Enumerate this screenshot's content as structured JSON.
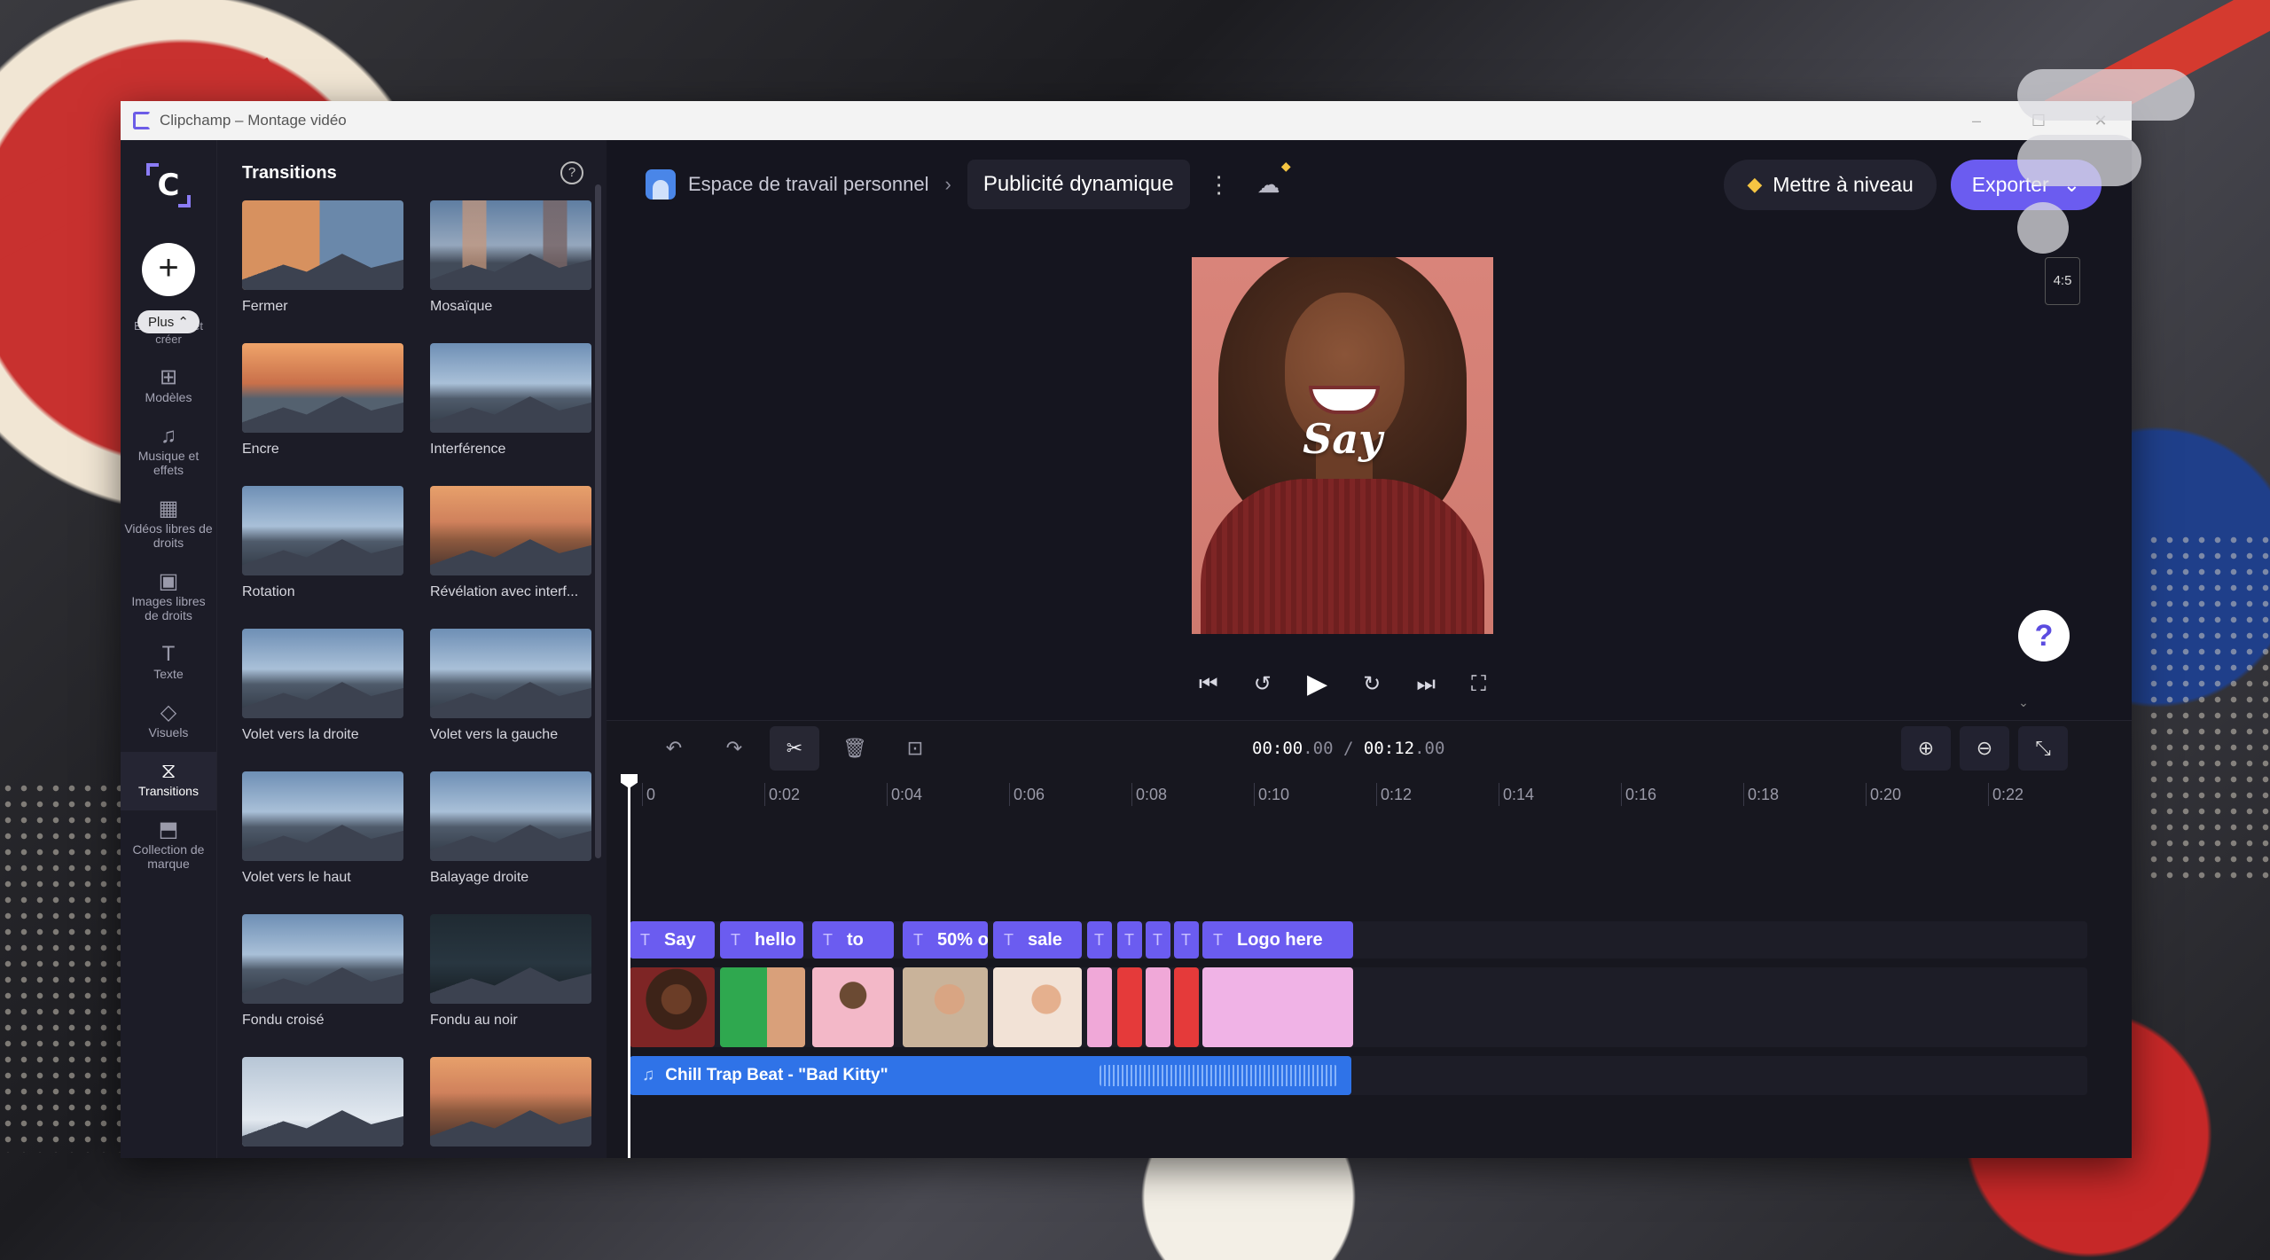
{
  "window": {
    "title": "Clipchamp – Montage vidéo"
  },
  "rail": {
    "logo": "C",
    "add_label": "+",
    "plus_pill": "Plus ⌃",
    "plus_under": "Enregistrer et créer",
    "items": [
      {
        "icon": "template-icon",
        "glyph": "⊞",
        "label": "Modèles"
      },
      {
        "icon": "music-icon",
        "glyph": "♫",
        "label": "Musique et effets"
      },
      {
        "icon": "film-icon",
        "glyph": "▦",
        "label": "Vidéos libres de droits"
      },
      {
        "icon": "image-icon",
        "glyph": "▣",
        "label": "Images libres de droits"
      },
      {
        "icon": "text-icon",
        "glyph": "T",
        "label": "Texte"
      },
      {
        "icon": "shapes-icon",
        "glyph": "◇",
        "label": "Visuels"
      },
      {
        "icon": "transitions-icon",
        "glyph": "⧖",
        "label": "Transitions"
      },
      {
        "icon": "brand-icon",
        "glyph": "⬒",
        "label": "Collection de marque"
      }
    ]
  },
  "panel": {
    "title": "Transitions",
    "help": "?",
    "collapse": "‹",
    "tiles": [
      {
        "label": "Fermer",
        "style": "split"
      },
      {
        "label": "Mosaïque",
        "style": "mosaic"
      },
      {
        "label": "Encre",
        "style": "cloud"
      },
      {
        "label": "Interférence",
        "style": ""
      },
      {
        "label": "Rotation",
        "style": ""
      },
      {
        "label": "Révélation avec interf...",
        "style": "warm"
      },
      {
        "label": "Volet vers la droite",
        "style": ""
      },
      {
        "label": "Volet vers la gauche",
        "style": ""
      },
      {
        "label": "Volet vers le haut",
        "style": ""
      },
      {
        "label": "Balayage droite",
        "style": ""
      },
      {
        "label": "Fondu croisé",
        "style": ""
      },
      {
        "label": "Fondu au noir",
        "style": "dark"
      },
      {
        "label": "",
        "style": "light"
      },
      {
        "label": "",
        "style": "warm"
      }
    ]
  },
  "topbar": {
    "workspace": "Espace de travail personnel",
    "separator": "›",
    "project_name": "Publicité dynamique",
    "kebab": "⋮",
    "cloud": "☁",
    "upgrade_label": "Mettre à niveau",
    "export_label": "Exporter",
    "export_chevron": "⌄",
    "ratio": "4:5"
  },
  "preview": {
    "overlay_text": "Say"
  },
  "player": {
    "skip_back": "⏮",
    "rewind": "↺",
    "play": "▶",
    "forward": "↻",
    "skip_forward": "⏭",
    "fullscreen": "⛶",
    "help": "?",
    "collapse": "⌄"
  },
  "timeline": {
    "tools": [
      {
        "name": "undo",
        "glyph": "↶"
      },
      {
        "name": "redo",
        "glyph": "↷"
      },
      {
        "name": "split",
        "glyph": "✂"
      },
      {
        "name": "delete",
        "glyph": "🗑"
      },
      {
        "name": "add-media",
        "glyph": "⊡"
      }
    ],
    "current_time": "00:00",
    "current_frac": ".00",
    "time_sep": "/",
    "total_time": "00:12",
    "total_frac": ".00",
    "zoom_in": "⊕",
    "zoom_out": "⊖",
    "fit": "⤡",
    "ticks": [
      "0",
      "0:02",
      "0:04",
      "0:06",
      "0:08",
      "0:10",
      "0:12",
      "0:14",
      "0:16",
      "0:18",
      "0:20",
      "0:22"
    ],
    "text_clips": [
      {
        "label": "Say"
      },
      {
        "label": "hello"
      },
      {
        "label": "to"
      },
      {
        "label": "50% o"
      },
      {
        "label": "sale"
      },
      {
        "label": ""
      },
      {
        "label": ""
      },
      {
        "label": ""
      },
      {
        "label": ""
      },
      {
        "label": "Logo here"
      }
    ],
    "text_icon": "T",
    "audio_clip": "Chill Trap Beat - \"Bad Kitty\"",
    "audio_icon": "♫"
  },
  "colors": {
    "accent": "#6b5cf0",
    "audio": "#2f73e8",
    "gem": "#f5c542",
    "pink": "#f0a8d8",
    "red": "#e53a3a"
  }
}
